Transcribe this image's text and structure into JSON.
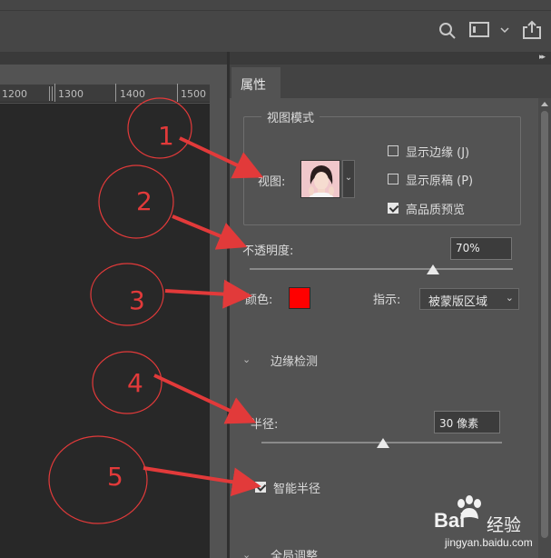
{
  "ruler": {
    "labels": [
      "1200",
      "1300",
      "1400",
      "1500"
    ]
  },
  "panel": {
    "tab_label": "属性",
    "view_mode": {
      "group_title": "视图模式",
      "view_label": "视图:",
      "options": [
        {
          "label": "显示边缘 (J)",
          "checked": false
        },
        {
          "label": "显示原稿 (P)",
          "checked": false
        },
        {
          "label": "高品质预览",
          "checked": true
        }
      ]
    },
    "opacity": {
      "label": "不透明度:",
      "value": "70%",
      "level_percent": 70
    },
    "color": {
      "label": "颜色:",
      "swatch_color": "#ff0000",
      "indicate_label": "指示:",
      "indicate_value": "被蒙版区域"
    },
    "edge_detection": {
      "section_title": "边缘检测",
      "radius_label": "半径:",
      "radius_value": "30 像素",
      "smart_radius_label": "智能半径",
      "smart_radius_checked": true
    },
    "global_refine": {
      "section_title": "全局调整"
    }
  },
  "annotations": {
    "numbers": [
      "1",
      "2",
      "3",
      "4",
      "5"
    ],
    "color": "#e23a3a"
  },
  "watermark": {
    "brand": "Bai",
    "brand_suffix": "经验",
    "url": "jingyan.baidu.com"
  }
}
